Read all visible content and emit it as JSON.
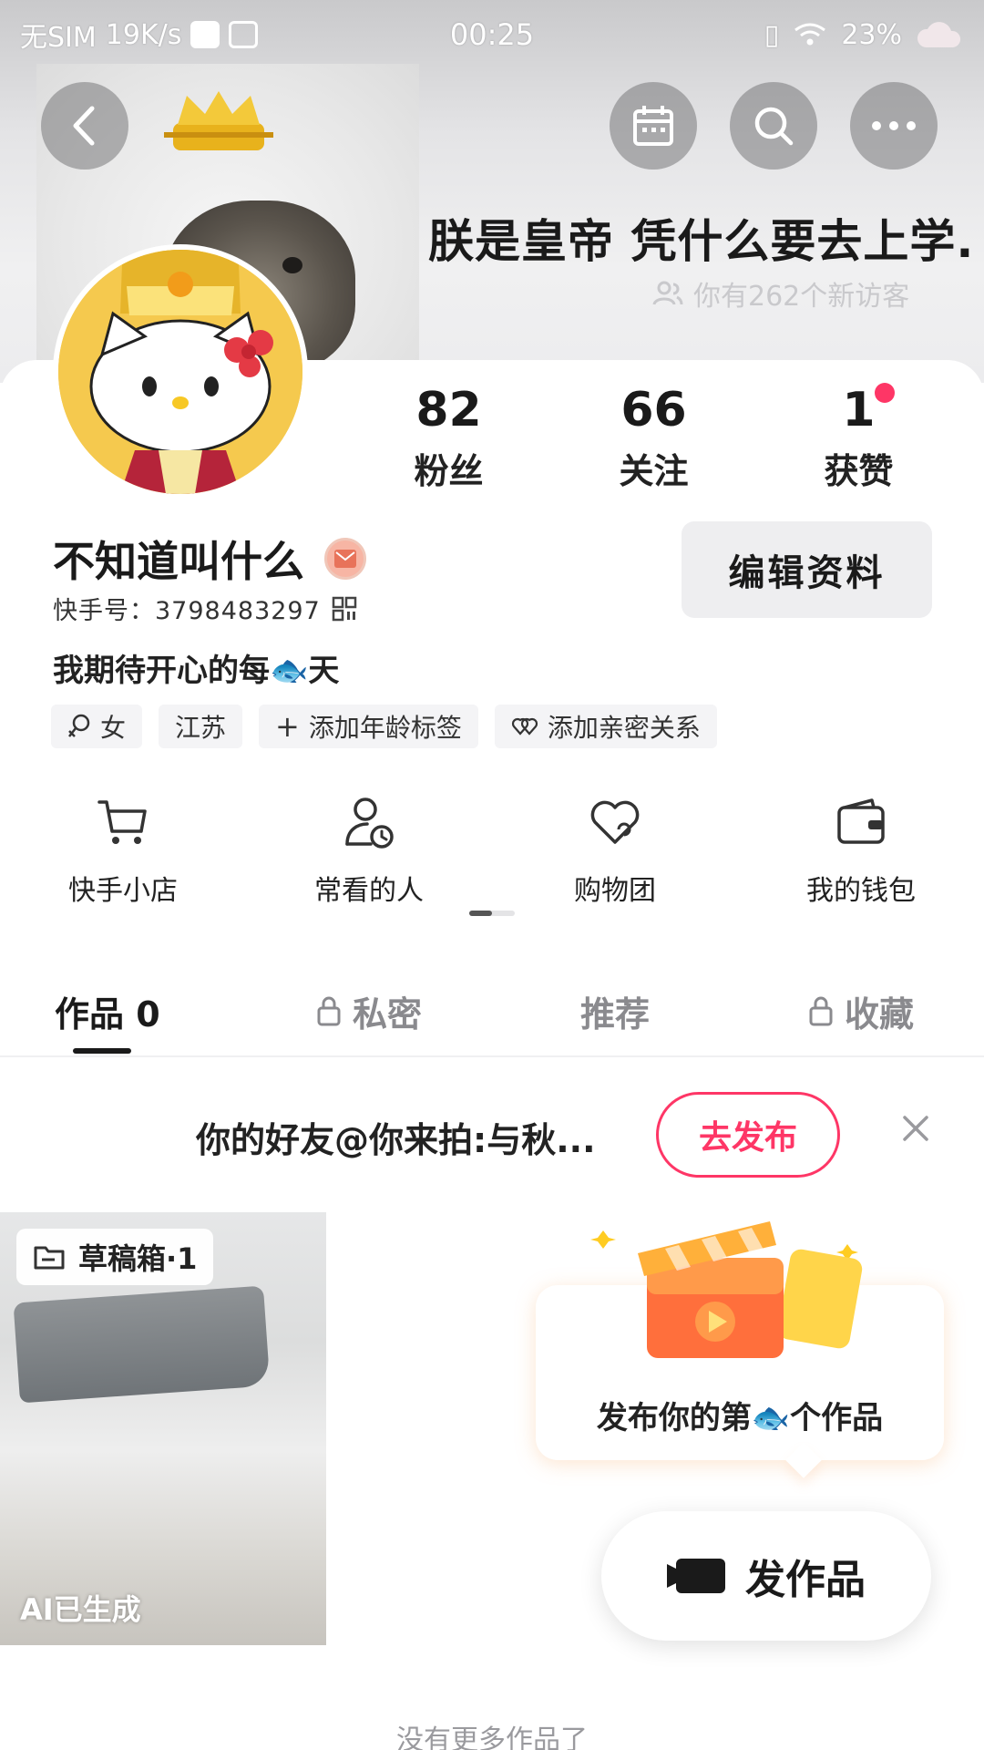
{
  "status_bar": {
    "carrier": "无SIM",
    "speed": "19K/s",
    "time": "00:25",
    "battery": "23%"
  },
  "header": {
    "caption": "朕是皇帝 凭什么要去上学.",
    "visitors": "你有262个新访客"
  },
  "profile": {
    "stats": [
      {
        "value": "82",
        "label": "粉丝"
      },
      {
        "value": "66",
        "label": "关注"
      },
      {
        "value": "1",
        "label": "获赞"
      }
    ],
    "name": "不知道叫什么",
    "kwai_id": "快手号：3798483297",
    "edit_label": "编辑资料",
    "bio": "我期待开心的每🐟天",
    "tags": [
      "女",
      "江苏",
      "添加年龄标签",
      "添加亲密关系"
    ]
  },
  "shortcuts": [
    {
      "label": "快手小店",
      "icon": "cart-icon"
    },
    {
      "label": "常看的人",
      "icon": "person-clock-icon"
    },
    {
      "label": "购物团",
      "icon": "heart-group-icon"
    },
    {
      "label": "我的钱包",
      "icon": "wallet-icon"
    }
  ],
  "tabs": [
    {
      "label": "作品 0",
      "active": true
    },
    {
      "label": "私密",
      "locked": true
    },
    {
      "label": "推荐"
    },
    {
      "label": "收藏",
      "locked": true
    }
  ],
  "invite": {
    "text": "你的好友@你来拍:与秋...",
    "button": "去发布"
  },
  "draft": {
    "label": "草稿箱·1",
    "ai_tag": "AI已生成"
  },
  "promo": {
    "text": "发布你的第🐟个作品"
  },
  "fab": {
    "label": "发作品"
  },
  "footer": {
    "no_more": "没有更多作品了"
  },
  "colors": {
    "accent": "#fe3666",
    "text": "#1a1a1a",
    "muted": "#8a8a8e"
  }
}
